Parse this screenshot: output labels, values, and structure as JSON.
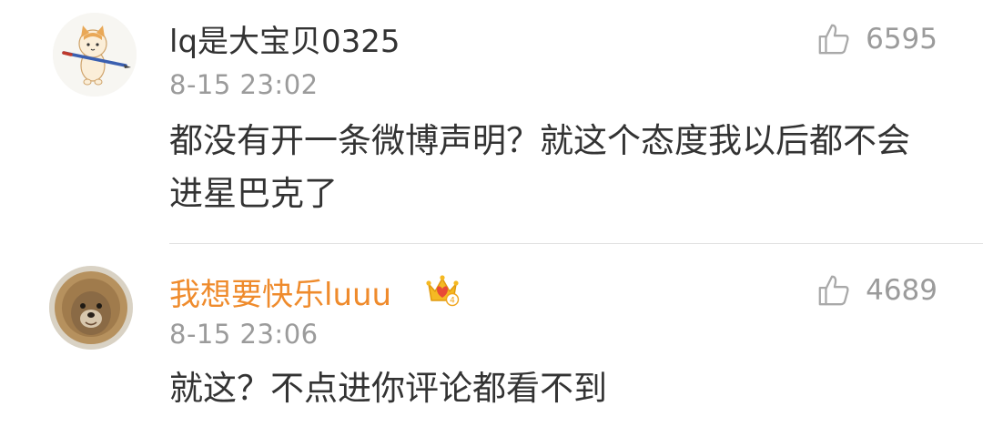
{
  "comments": [
    {
      "username": "lq是大宝贝0325",
      "timestamp": "8-15 23:02",
      "likes": "6595",
      "text": "都没有开一条微博声明？就这个态度我以后都不会进星巴克了",
      "avatar_icon": "cat-with-pencil-avatar"
    },
    {
      "username": "我想要快乐luuu",
      "timestamp": "8-15 23:06",
      "likes": "4689",
      "text": "就这？不点进你评论都看不到",
      "avatar_icon": "lion-dog-avatar",
      "badge_icon": "crown-badge-icon",
      "name_color": "#ef8b2c"
    }
  ],
  "badge_level": "4"
}
